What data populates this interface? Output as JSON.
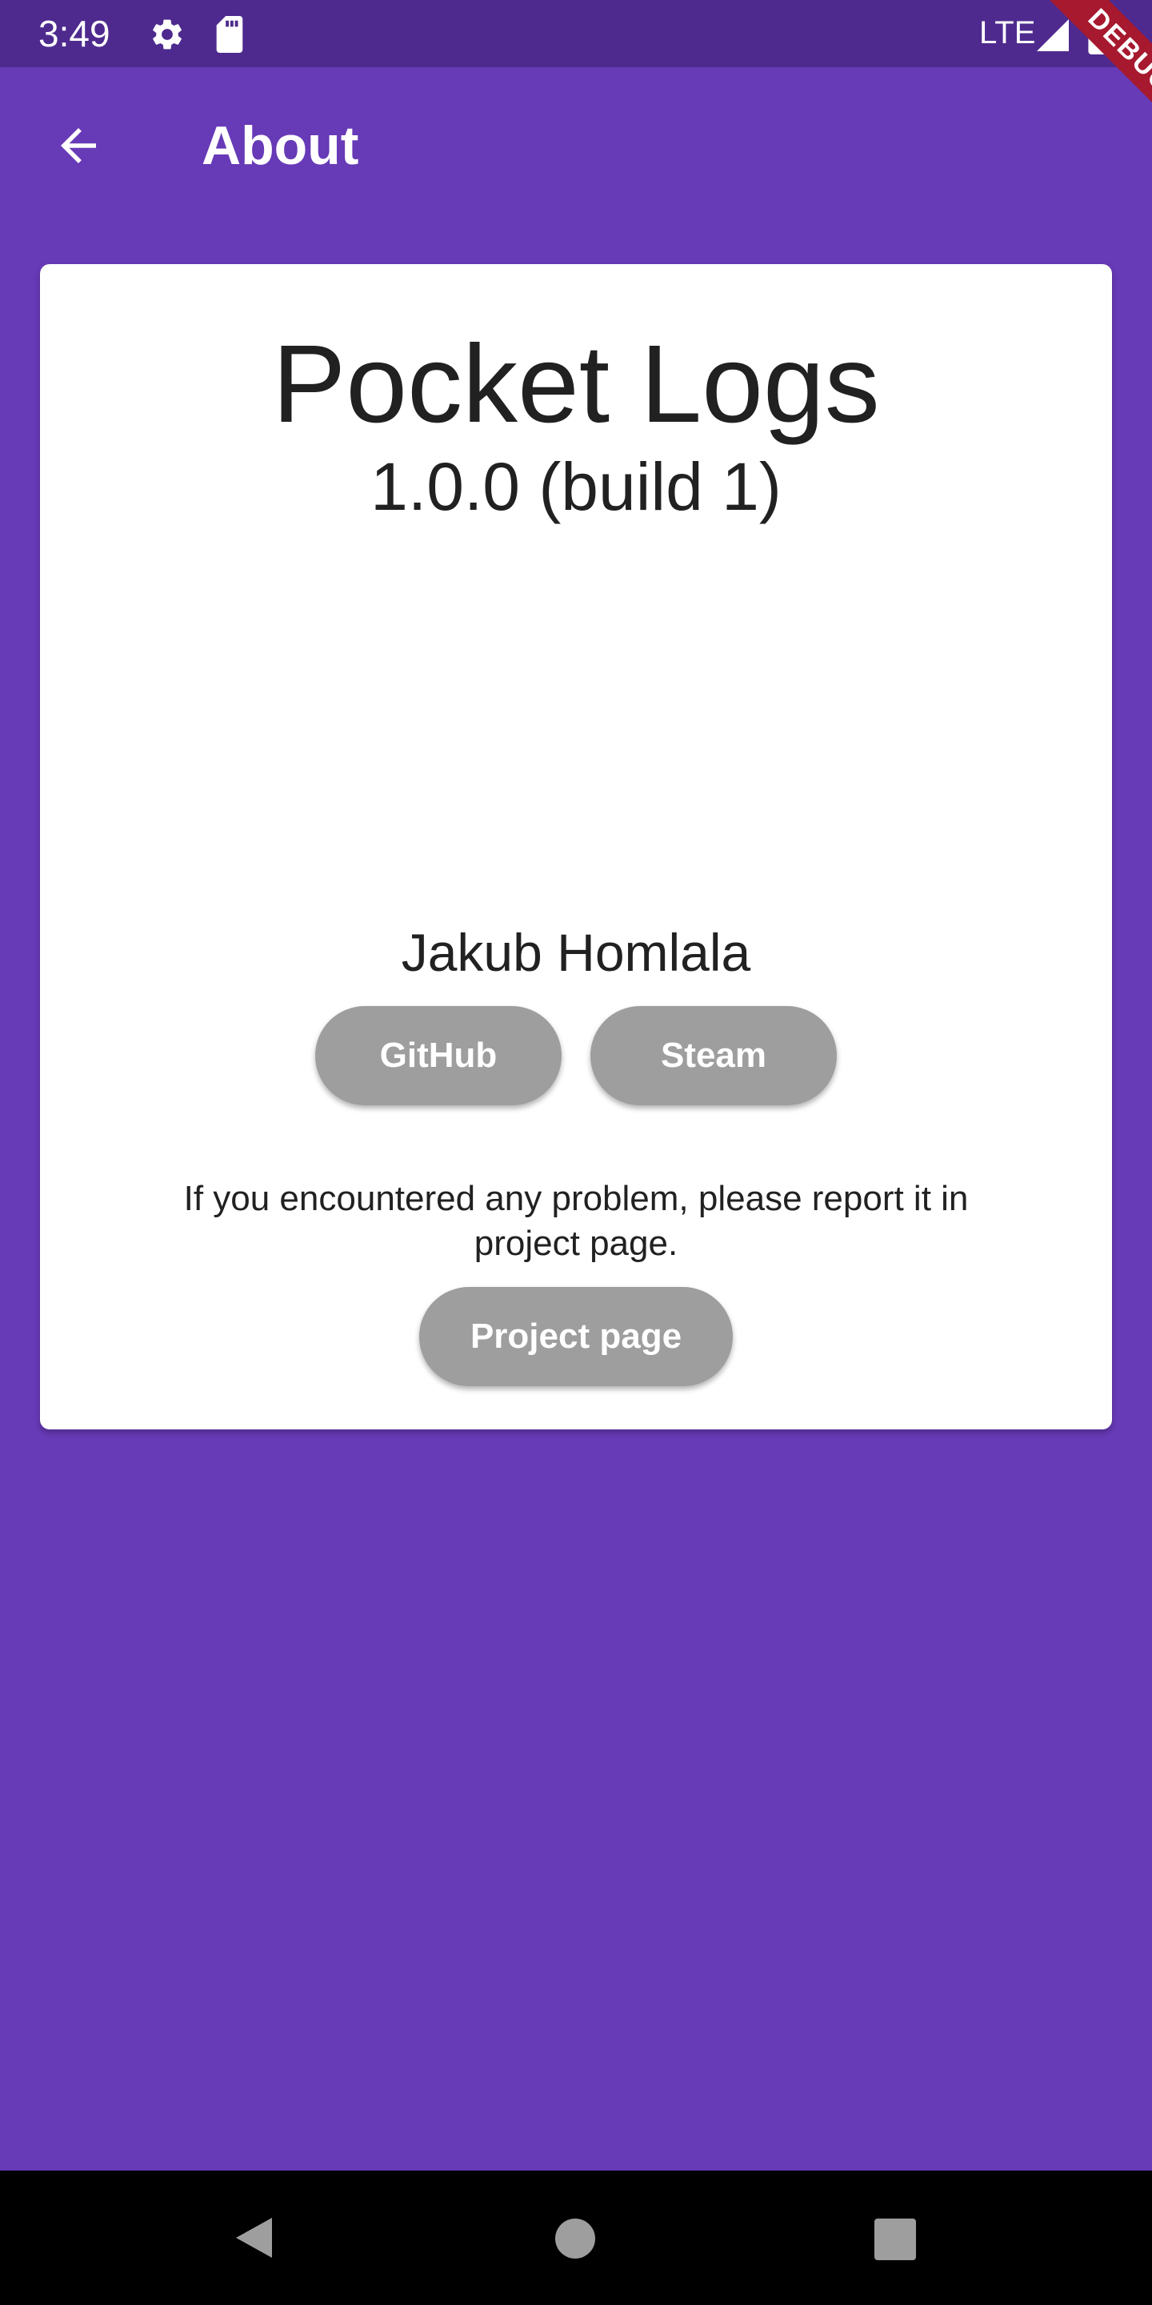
{
  "status_bar": {
    "time": "3:49",
    "network": "LTE",
    "icons": [
      "gear-icon",
      "sd-card-icon",
      "signal-icon",
      "battery-icon"
    ]
  },
  "app_bar": {
    "title": "About",
    "back_icon": "arrow-back-icon"
  },
  "debug_banner": "DEBUG",
  "card": {
    "app_name": "Pocket Logs",
    "version": "1.0.0 (build 1)",
    "author": "Jakub Homlala",
    "github_label": "GitHub",
    "steam_label": "Steam",
    "report_text": "If you encountered any problem, please report it in project page.",
    "project_label": "Project page"
  },
  "nav_bar": {
    "icons": [
      "back-triangle-icon",
      "home-circle-icon",
      "recents-square-icon"
    ]
  },
  "colors": {
    "primary": "#673ab7",
    "status_bar": "#4e2a8e",
    "button": "#9e9e9e",
    "debug_ribbon": "#a6192e"
  }
}
